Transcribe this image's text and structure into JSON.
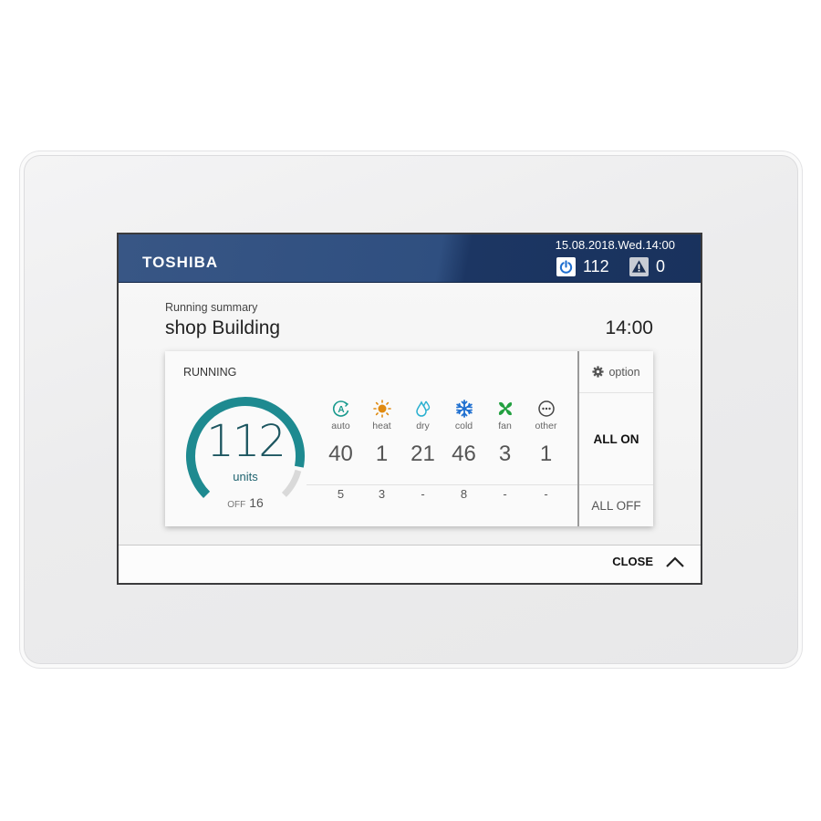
{
  "header": {
    "brand": "TOSHIBA",
    "datetime": "15.08.2018.Wed.14:00",
    "power_count": "112",
    "alarm_count": "0",
    "power_icon": "power-icon",
    "alarm_icon": "warning-icon"
  },
  "page": {
    "subtitle": "Running summary",
    "title": "shop Building",
    "clock": "14:00"
  },
  "summary": {
    "status_label": "RUNNING",
    "running_units": "112",
    "units_label": "units",
    "off_label": "OFF",
    "off_units": "16",
    "running_fraction": 0.875,
    "colors": {
      "running": "#1e8a90",
      "off": "#d9d9d9"
    }
  },
  "modes": [
    {
      "name": "auto",
      "icon": "auto-mode-icon",
      "color": "#1a9a8e",
      "running": "40",
      "off": "5"
    },
    {
      "name": "heat",
      "icon": "sun-icon",
      "color": "#e08a10",
      "running": "1",
      "off": "3"
    },
    {
      "name": "dry",
      "icon": "droplet-icon",
      "color": "#2ab0d0",
      "running": "21",
      "off": "-"
    },
    {
      "name": "cold",
      "icon": "snowflake-icon",
      "color": "#1e6fd0",
      "running": "46",
      "off": "8"
    },
    {
      "name": "fan",
      "icon": "fan-icon",
      "color": "#22a040",
      "running": "3",
      "off": "-"
    },
    {
      "name": "other",
      "icon": "more-icon",
      "color": "#444444",
      "running": "1",
      "off": "-"
    }
  ],
  "actions": {
    "option_label": "option",
    "all_on_label": "ALL ON",
    "all_off_label": "ALL OFF"
  },
  "footer": {
    "close_label": "CLOSE"
  }
}
